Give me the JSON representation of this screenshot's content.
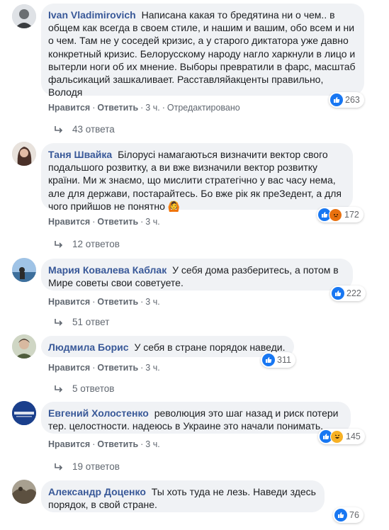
{
  "ui": {
    "like_label": "Нравится",
    "reply_label": "Ответить",
    "separator": "·"
  },
  "comments": [
    {
      "author": "Ivan Vladimirovich",
      "text": "Написана какая то бредятина ни о чем.. в общем как всегда в своем стиле, и нашим и вашим, обо всем и ни о чем. Там не у соседей кризис, а у старого диктатора уже давно конкретный кризис. Белорусскому народу нагло харкнули в лицо и вытерли ноги об их мнение. Выборы превратили в фарс, масштаб фальсикаций зашкаливает. Расставляйакценты правильно, Володя",
      "time": "3 ч.",
      "edited": "Отредактировано",
      "reactions": [
        "like"
      ],
      "reaction_count": "263",
      "replies": "43 ответа",
      "avatar_color": "#6b6f72"
    },
    {
      "author": "Таня Швайка",
      "text": "Білорусі намагаються визначити вектор свого подальшого розвитку, а ви вже визначили вектор розвитку країни. Ми ж знаємо, що мислити стратегічно у вас часу нема, але для держави, постарайтесь. Бо вже рік як преЗедент, а для чого прийшов не понятно 🙆",
      "time": "3 ч.",
      "reactions": [
        "like",
        "angry"
      ],
      "reaction_count": "172",
      "replies": "12 ответов",
      "avatar_color": "#8a6f63"
    },
    {
      "author": "Мария Ковалева Каблак",
      "text": "У себя дома разберитесь, а потом в Мире советы свои советуете.",
      "time": "3 ч.",
      "reactions": [
        "like"
      ],
      "reaction_count": "222",
      "replies": "51 ответ",
      "avatar_color": "#6e98c2"
    },
    {
      "author": "Людмила Борис",
      "text": "У себя в стране порядок наведи.",
      "time": "3 ч.",
      "reactions": [
        "like"
      ],
      "reaction_count": "311",
      "replies": "5 ответов",
      "avatar_color": "#7d8a6a"
    },
    {
      "author": "Евгений Холостенко",
      "text": "революция это шаг назад и риск потери тер. целостности. надеюсь в Украине это начали понимать.",
      "time": "3 ч.",
      "reactions": [
        "like",
        "haha"
      ],
      "reaction_count": "145",
      "replies": "19 ответов",
      "avatar_color": "#1a3f8c",
      "avatar_text": "HOLOSTENKO"
    },
    {
      "author": "Александр Доценко",
      "text": "Ты хоть туда не лезь. Наведи здесь порядок, в свой стране.",
      "time": "",
      "reactions": [
        "like"
      ],
      "reaction_count": "76",
      "avatar_color": "#5c5040"
    }
  ]
}
